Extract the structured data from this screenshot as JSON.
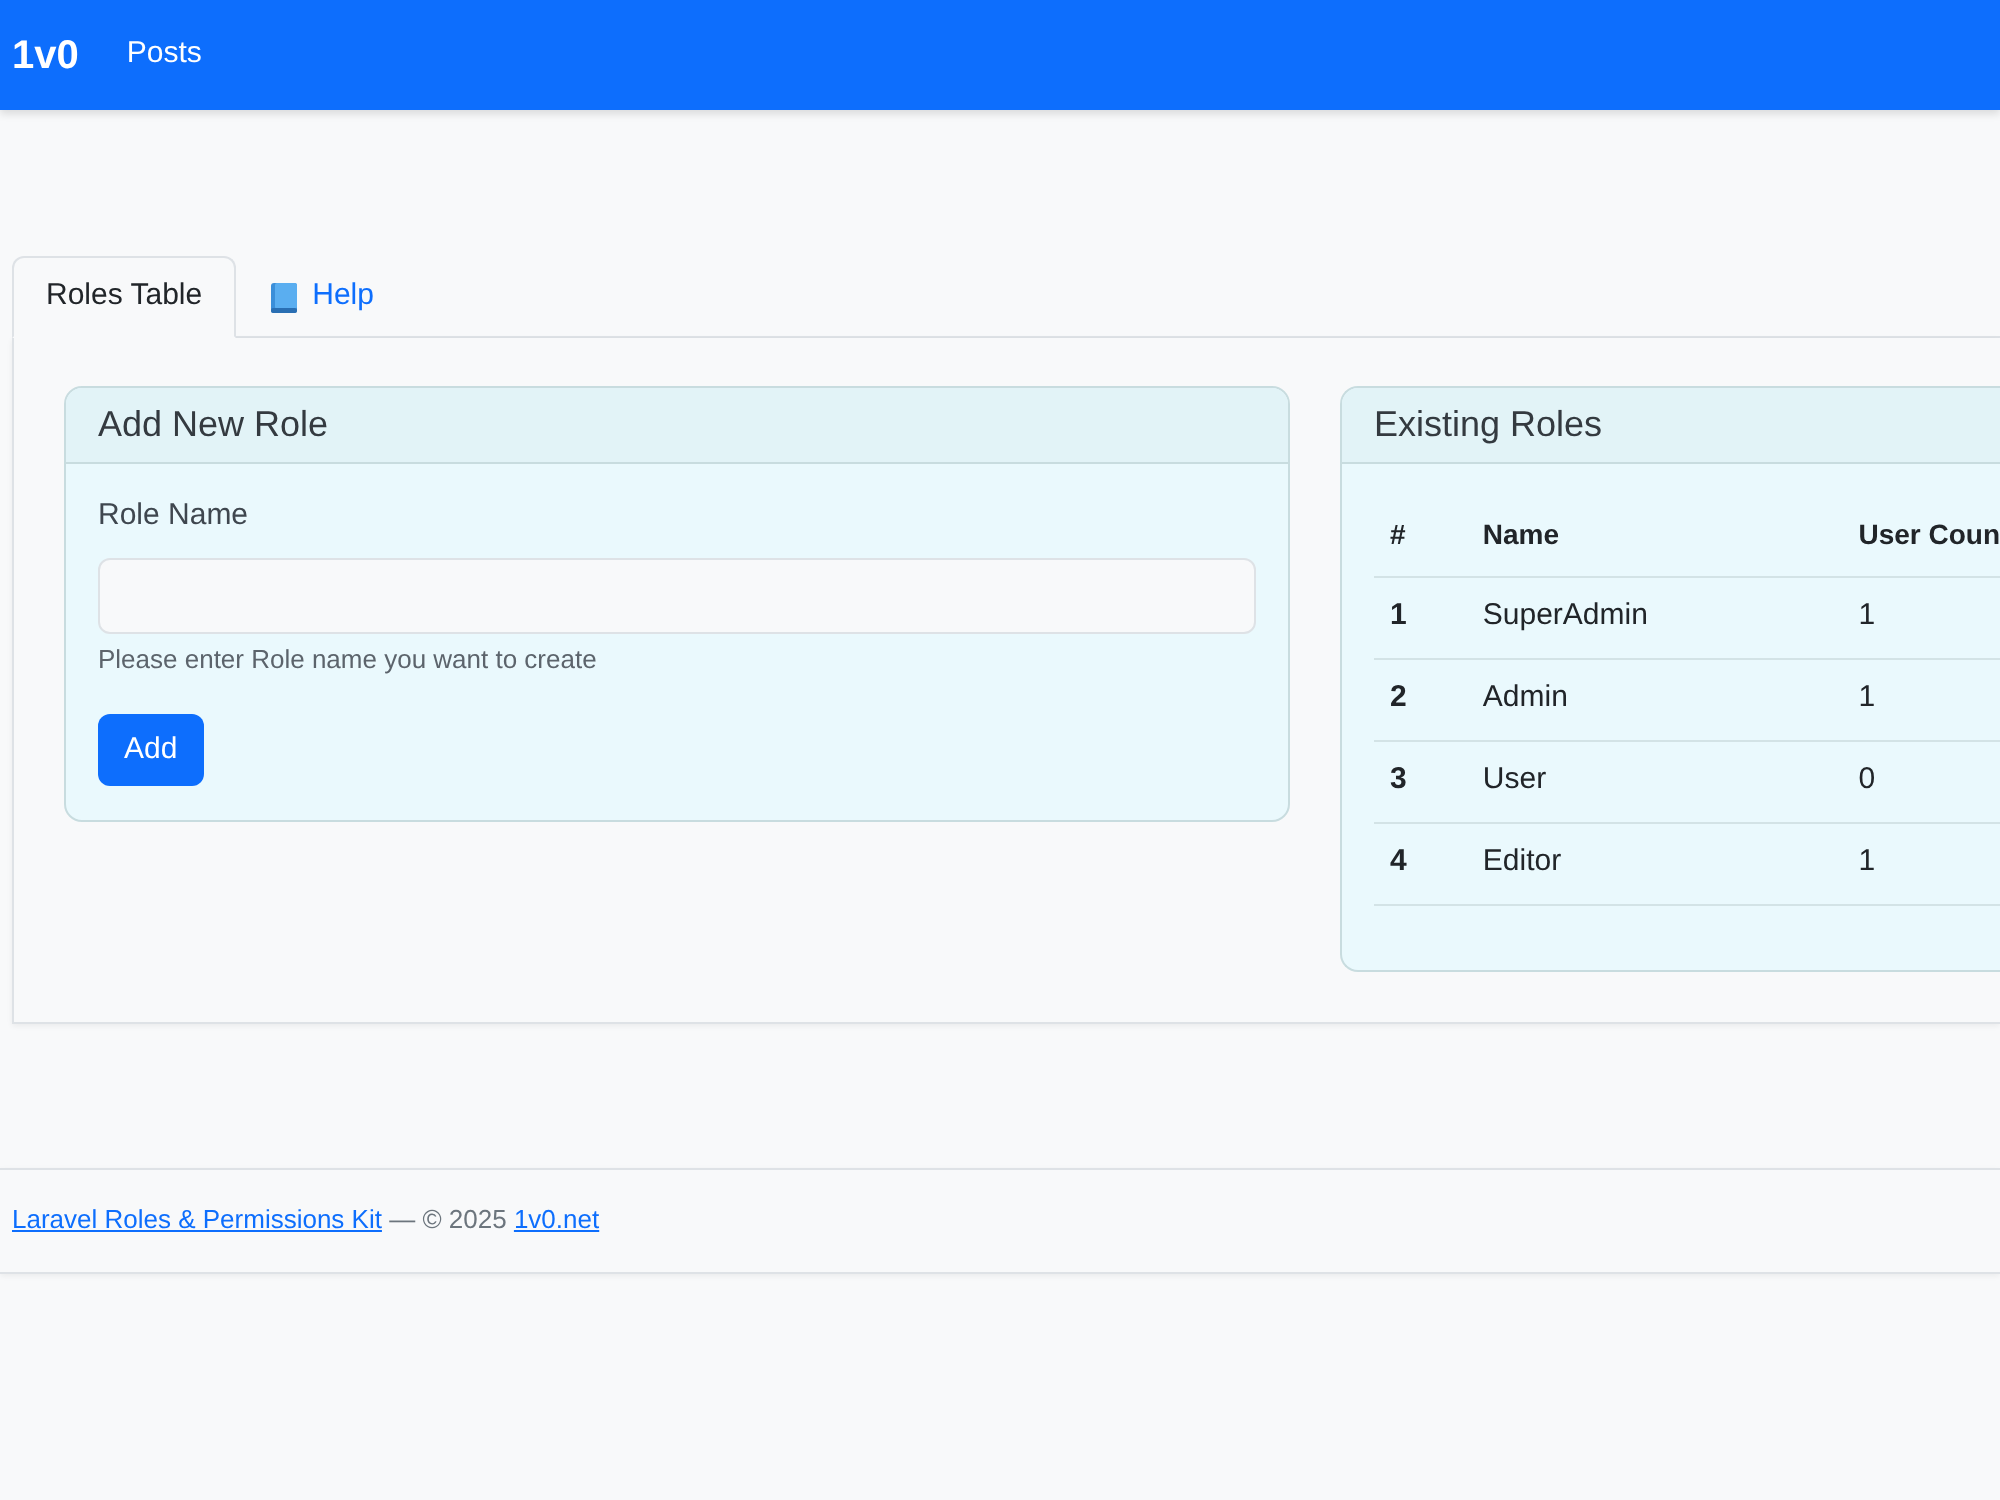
{
  "navbar": {
    "brand": "1v0",
    "links": [
      {
        "label": "Posts"
      }
    ]
  },
  "tabs": [
    {
      "label": "Roles Table",
      "selected": true,
      "kind": "plain"
    },
    {
      "label": "Help",
      "selected": false,
      "kind": "icon"
    }
  ],
  "add_role_card": {
    "title": "Add New Role",
    "field_label": "Role Name",
    "help_text": "Please enter Role name you want to create",
    "button": "Add"
  },
  "roles_card": {
    "title": "Existing Roles",
    "table": {
      "columns": [
        "#",
        "Name",
        "User Coun"
      ],
      "rows": [
        [
          "1",
          "SuperAdmin",
          "1"
        ],
        [
          "2",
          "Admin",
          "1"
        ],
        [
          "3",
          "User",
          "0"
        ],
        [
          "4",
          "Editor",
          "1"
        ]
      ]
    }
  },
  "footer": {
    "link": "Laravel Roles & Permissions Kit",
    "text": "— © 2025",
    "site_link": "1v0.net"
  }
}
